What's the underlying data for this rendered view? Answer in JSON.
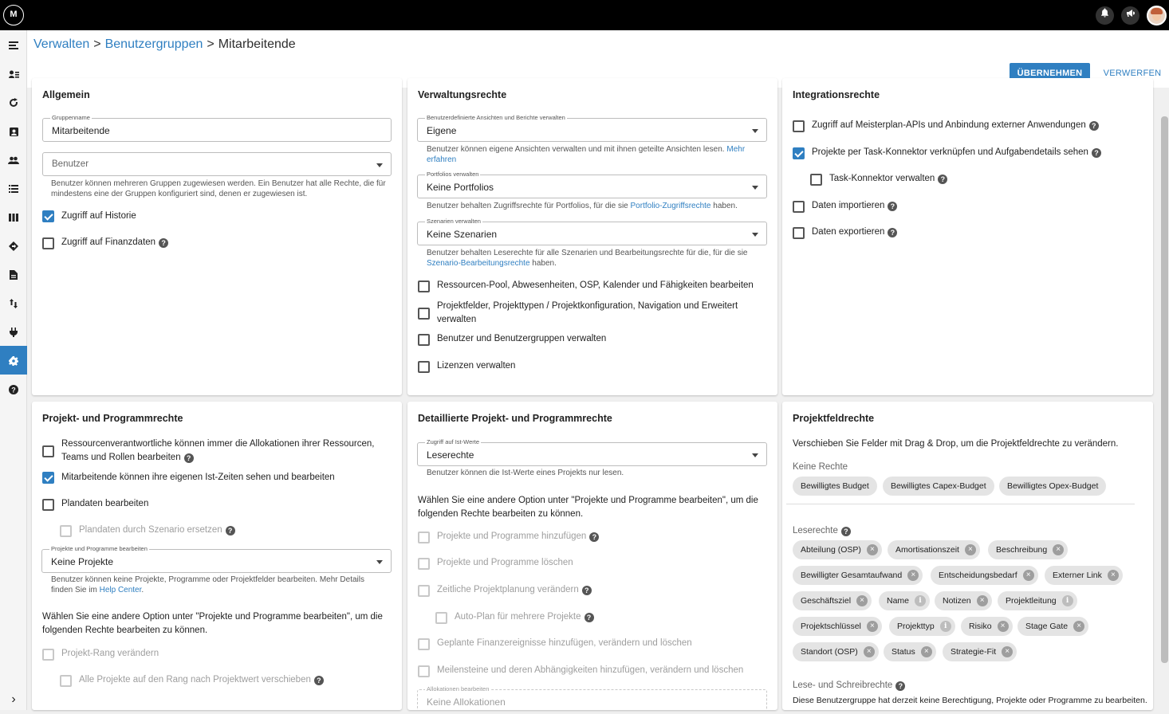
{
  "topbar": {
    "logo": "M",
    "icons": [
      "bell-icon",
      "megaphone-icon"
    ]
  },
  "sidebar": {
    "items": [
      "menu-icon",
      "user-list-icon",
      "refresh-icon",
      "badge-icon",
      "people-icon",
      "list-icon",
      "board-icon",
      "route-icon",
      "document-icon",
      "transfer-icon",
      "plug-icon",
      "gear-icon",
      "help-icon"
    ],
    "expand": "›"
  },
  "breadcrumb": {
    "item1": "Verwalten",
    "item2": "Benutzergruppen",
    "current": "Mitarbeitende",
    "sep": ">"
  },
  "actions": {
    "apply": "ÜBERNEHMEN",
    "discard": "VERWERFEN"
  },
  "general": {
    "title": "Allgemein",
    "group_name_label": "Gruppenname",
    "group_name_value": "Mitarbeitende",
    "users_placeholder": "Benutzer",
    "users_help": "Benutzer können mehreren Gruppen zugewiesen werden. Ein Benutzer hat alle Rechte, die für mindestens eine der Gruppen konfiguriert sind, denen er zugewiesen ist.",
    "history": "Zugriff auf Historie",
    "finance": "Zugriff auf Finanzdaten"
  },
  "admin": {
    "title": "Verwaltungsrechte",
    "views_label": "Benutzerdefinierte Ansichten und Berichte verwalten",
    "views_value": "Eigene",
    "views_help": "Benutzer können eigene Ansichten verwalten und mit ihnen geteilte Ansichten lesen. ",
    "views_link": "Mehr erfahren",
    "portfolios_label": "Portfolios verwalten",
    "portfolios_value": "Keine Portfolios",
    "portfolios_help1": "Benutzer behalten Zugriffsrechte für Portfolios, für die sie ",
    "portfolios_link": "Portfolio-Zugriffsrechte",
    "portfolios_help2": " haben.",
    "scenarios_label": "Szenarien verwalten",
    "scenarios_value": "Keine Szenarien",
    "scenarios_help1": "Benutzer behalten Leserechte für alle Szenarien und Bearbeitungsrechte für die, für die sie ",
    "scenarios_link": "Szenario-Bearbeitungsrechte",
    "scenarios_help2": " haben.",
    "opt1": "Ressourcen-Pool, Abwesenheiten, OSP, Kalender und Fähigkeiten bearbeiten",
    "opt2": "Projektfelder, Projekttypen / Projektkonfiguration, Navigation und Erweitert verwalten",
    "opt3": "Benutzer und Benutzergruppen verwalten",
    "opt4": "Lizenzen verwalten"
  },
  "integration": {
    "title": "Integrationsrechte",
    "opt1": "Zugriff auf Meisterplan-APIs und Anbindung externer Anwendungen",
    "opt2": "Projekte per Task-Konnektor verknüpfen und Aufgabendetails sehen",
    "opt3": "Task-Konnektor verwalten",
    "opt4": "Daten importieren",
    "opt5": "Daten exportieren"
  },
  "program": {
    "title": "Projekt- und Programmrechte",
    "opt1": "Ressourcenverantwortliche können immer die Allokationen ihrer Ressourcen, Teams und Rollen bearbeiten",
    "opt2": "Mitarbeitende können ihre eigenen Ist-Zeiten sehen und bearbeiten",
    "opt3": "Plandaten bearbeiten",
    "opt4": "Plandaten durch Szenario ersetzen",
    "edit_label": "Projekte und Programme bearbeiten",
    "edit_value": "Keine Projekte",
    "edit_help1": "Benutzer können keine Projekte, Programme oder Projektfelder bearbeiten. Mehr Details finden Sie im ",
    "edit_link": "Help Center",
    "edit_help2": ".",
    "note": "Wählen Sie eine andere Option unter \"Projekte und Programme bearbeiten\", um die folgenden Rechte bearbeiten zu können.",
    "opt5": "Projekt-Rang verändern",
    "opt6": "Alle Projekte auf den Rang nach Projektwert verschieben"
  },
  "detailed": {
    "title": "Detaillierte Projekt- und Programmrechte",
    "actuals_label": "Zugriff auf Ist-Werte",
    "actuals_value": "Leserechte",
    "actuals_help": "Benutzer können die Ist-Werte eines Projekts nur lesen.",
    "note": "Wählen Sie eine andere Option unter \"Projekte und Programme bearbeiten\", um die folgenden Rechte bearbeiten zu können.",
    "opt1": "Projekte und Programme hinzufügen",
    "opt2": "Projekte und Programme löschen",
    "opt3": "Zeitliche Projektplanung verändern",
    "opt4": "Auto-Plan für mehrere Projekte",
    "opt5": "Geplante Finanzereignisse hinzufügen, verändern und löschen",
    "opt6": "Meilensteine und deren Abhängigkeiten hinzufügen, verändern und löschen",
    "alloc_label": "Allokationen bearbeiten",
    "alloc_value": "Keine Allokationen"
  },
  "fields": {
    "title": "Projektfeldrechte",
    "intro": "Verschieben Sie Felder mit Drag & Drop, um die Projektfeldrechte zu verändern.",
    "none_label": "Keine Rechte",
    "none": [
      "Bewilligtes Budget",
      "Bewilligtes Capex-Budget",
      "Bewilligtes Opex-Budget"
    ],
    "read_label": "Leserechte",
    "read": [
      "Abteilung (OSP)",
      "Amortisationszeit",
      "Beschreibung",
      "Bewilligter Gesamtaufwand",
      "Entscheidungsbedarf",
      "Externer Link",
      "Geschäftsziel",
      "Name",
      "Notizen",
      "Projektleitung",
      "Projektschlüssel",
      "Projekttyp",
      "Risiko",
      "Stage Gate",
      "Standort (OSP)",
      "Status",
      "Strategie-Fit"
    ],
    "write_label": "Lese- und Schreibrechte",
    "write_note": "Diese Benutzergruppe hat derzeit keine Berechtigung, Projekte oder Programme zu bearbeiten."
  },
  "colors": {
    "accent": "#2f7fc1",
    "topbar": "#000000"
  }
}
